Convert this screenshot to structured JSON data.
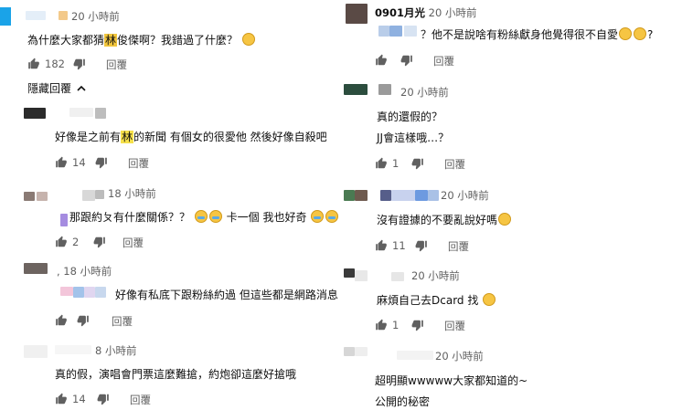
{
  "left": {
    "c1": {
      "time": "20 小時前",
      "text_pre": "為什麼大家都猜",
      "text_hl": "林",
      "text_post": "俊傑啊？我錯過了什麼？",
      "likes": "182",
      "reply": "回覆"
    },
    "hide_replies": "隱藏回覆",
    "c2": {
      "text_pre": "好像是之前有",
      "text_hl": "林",
      "text_post": "的新聞 有個女的很愛他 然後好像自殺吧",
      "likes": "14",
      "reply": "回覆"
    },
    "c3": {
      "time": "18 小時前",
      "text_pre": "那跟約ㄆ有什麼關係？？",
      "text_post": "卡一個 我也好奇",
      "likes": "2",
      "reply": "回覆"
    },
    "c4": {
      "time": ", 18 小時前",
      "text": "好像有私底下跟粉絲約過 但這些都是網路消息",
      "reply": "回覆"
    },
    "c5": {
      "time": "8 小時前",
      "text": "真的假，演唱會門票這麼難搶，約炮卻這麼好搶哦",
      "likes": "14",
      "reply": "回覆"
    }
  },
  "right": {
    "c1": {
      "author": "0901月光",
      "time": "20 小時前",
      "text": "？他不是說啥有粉絲獻身他覺得很不自愛",
      "reply": "回覆"
    },
    "c2": {
      "time": "20 小時前",
      "line1": "真的還假的？",
      "line2": "JJ會這樣哦…？",
      "likes": "1",
      "reply": "回覆"
    },
    "c3": {
      "time": "20 小時前",
      "text": "沒有證據的不要亂說好嗎",
      "likes": "11",
      "reply": "回覆"
    },
    "c4": {
      "time": "20 小時前",
      "text": "麻煩自己去Dcard 找",
      "likes": "1",
      "reply": "回覆"
    },
    "c5": {
      "time": "20 小時前",
      "line1": "超明顯wwwww大家都知道的~",
      "line2": "公開的秘密"
    }
  },
  "icons": {
    "like": "thumb-up-icon",
    "dislike": "thumb-down-icon",
    "chevron": "chevron-up-icon"
  }
}
